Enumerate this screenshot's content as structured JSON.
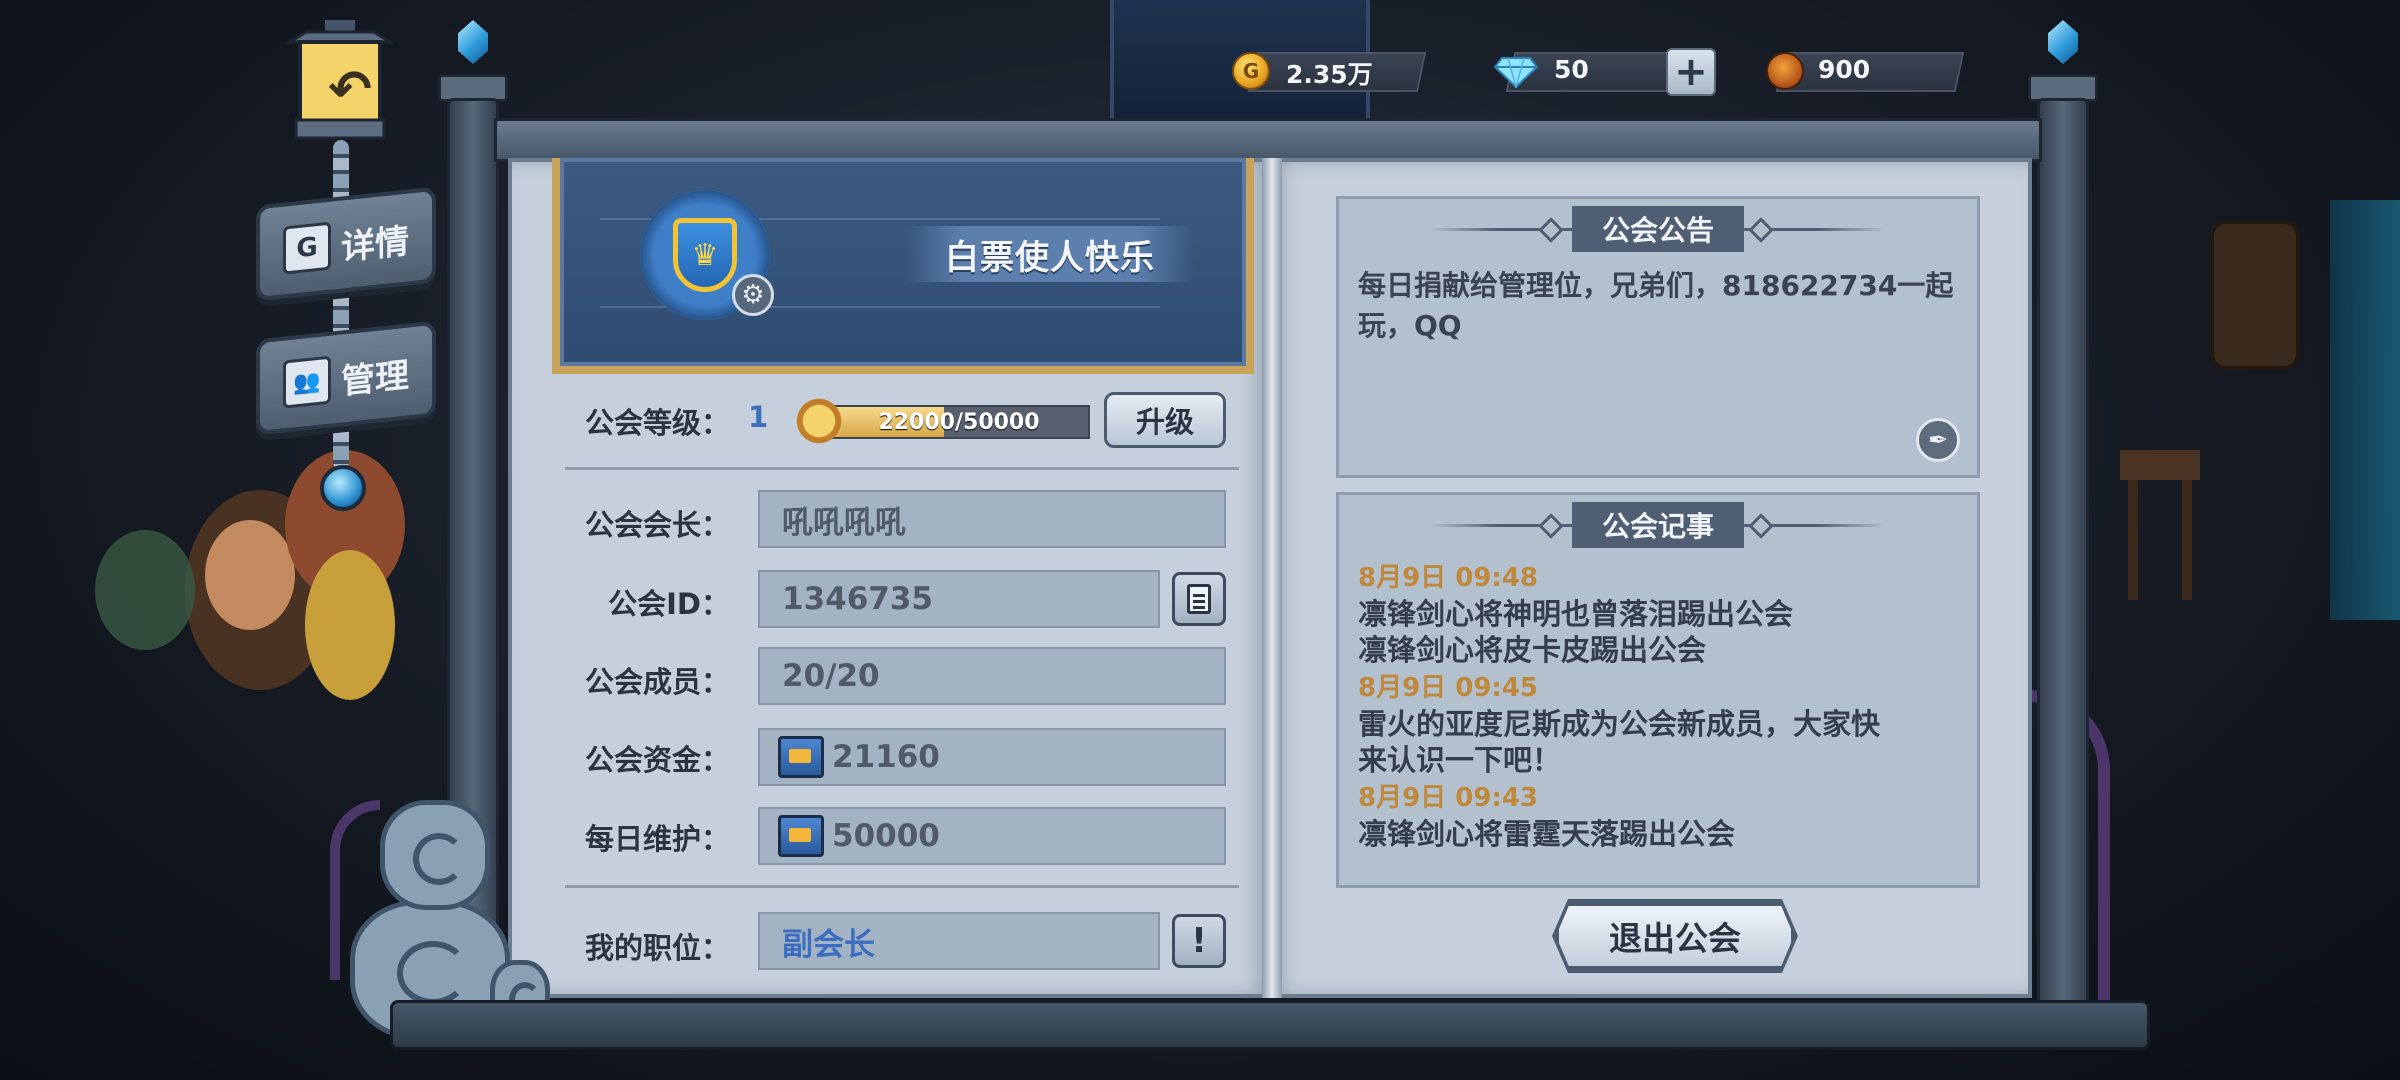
{
  "currency": {
    "gold": "2.35万",
    "diamonds": "50",
    "medals": "900",
    "gold_icon_glyph": "G",
    "plus_glyph": "+"
  },
  "nav": {
    "details_label": "详情",
    "details_icon_glyph": "G",
    "manage_label": "管理",
    "manage_icon_glyph": "👥",
    "back_glyph": "↶"
  },
  "guild": {
    "name": "白票使人快乐",
    "emblem_glyph": "♛",
    "settings_glyph": "⚙",
    "level_label": "公会等级：",
    "level": "1",
    "xp_text": "22000/50000",
    "xp_fraction": 0.44,
    "upgrade_button": "升级",
    "leader_label": "公会会长：",
    "leader": "吼吼吼吼",
    "id_label": "公会ID：",
    "id": "1346735",
    "members_label": "公会成员：",
    "members": "20/20",
    "funds_label": "公会资金：",
    "funds": "21160",
    "upkeep_label": "每日维护：",
    "upkeep": "50000",
    "position_label": "我的职位：",
    "position": "副会长",
    "info_glyph": "!"
  },
  "notice": {
    "title": "公会公告",
    "text": "每日捐献给管理位，兄弟们，818622734一起玩，QQ",
    "edit_glyph": "✒"
  },
  "log": {
    "title": "公会记事",
    "entries": [
      {
        "time": "8月9日 09:48",
        "lines": [
          "凛锋剑心将神明也曾落泪踢出公会",
          "凛锋剑心将皮卡皮踢出公会"
        ]
      },
      {
        "time": "8月9日 09:45",
        "lines": [
          "雷火的亚度尼斯成为公会新成员，大家快",
          "来认识一下吧！"
        ]
      },
      {
        "time": "8月9日 09:43",
        "lines": [
          "凛锋剑心将雷霆天落踢出公会"
        ]
      }
    ]
  },
  "actions": {
    "quit_button": "退出公会"
  },
  "colors": {
    "accent_blue": "#3b6ec0",
    "log_time": "#c0883a",
    "banner_gold": "#c9a45a"
  }
}
